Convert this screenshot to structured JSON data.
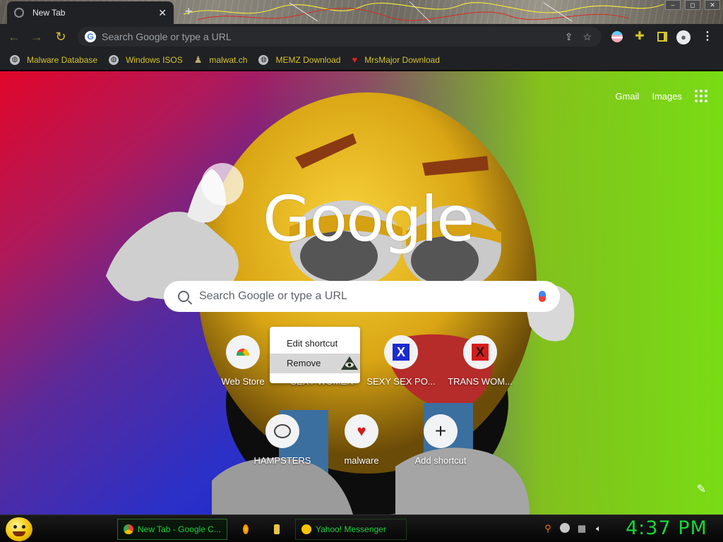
{
  "browser": {
    "tab_title": "New Tab",
    "omnibox_placeholder": "Search Google or type a URL",
    "bookmarks": [
      {
        "label": "Malware Database",
        "icon": "globe-icon"
      },
      {
        "label": "Windows ISOS",
        "icon": "globe-icon"
      },
      {
        "label": "malwat.ch",
        "icon": "user-icon"
      },
      {
        "label": "MEMZ Download",
        "icon": "globe-icon"
      },
      {
        "label": "MrsMajor Download",
        "icon": "heart-icon"
      }
    ],
    "accent_color": "#d5c32d"
  },
  "page": {
    "top_links": {
      "gmail": "Gmail",
      "images": "Images"
    },
    "logo_text": "Google",
    "search_placeholder": "Search Google or type a URL",
    "shortcuts": [
      {
        "label": "Web Store",
        "icon": "webstore-icon"
      },
      {
        "label": "SEXY WOMEN",
        "icon": "eye-icon"
      },
      {
        "label": "SEXY SEX PO...",
        "icon": "x-icon"
      },
      {
        "label": "TRANS WOM...",
        "icon": "x-icon"
      },
      {
        "label": "HAMPSTERS",
        "icon": "hamster-icon"
      },
      {
        "label": "malware",
        "icon": "heart-icon"
      },
      {
        "label": "Add shortcut",
        "icon": "plus-icon"
      }
    ],
    "context_menu": {
      "edit": "Edit shortcut",
      "remove": "Remove"
    }
  },
  "taskbar": {
    "windows": [
      {
        "label": "New Tab - Google C...",
        "icon": "chrome-icon"
      },
      {
        "label": "",
        "icon": "firefox-icon"
      },
      {
        "label": "",
        "icon": "folder-icon"
      },
      {
        "label": "Yahoo! Messenger",
        "icon": "smiley-icon"
      }
    ],
    "clock": "4:37 PM",
    "clock_color": "#18d63a"
  }
}
